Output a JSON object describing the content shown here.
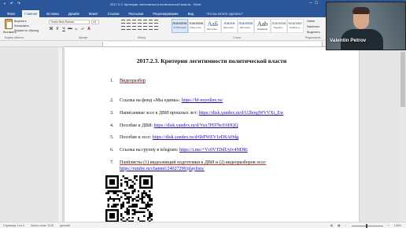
{
  "window": {
    "title": "2017.2.3. Критерии легитимности политической власти - Word",
    "quick_access": [
      "save-icon",
      "undo-icon",
      "redo-icon"
    ]
  },
  "tabs": [
    {
      "label": "Файл",
      "active": false
    },
    {
      "label": "Главная",
      "active": true
    },
    {
      "label": "Вставка",
      "active": false
    },
    {
      "label": "Дизайн",
      "active": false
    },
    {
      "label": "Макет",
      "active": false
    },
    {
      "label": "Ссылки",
      "active": false
    },
    {
      "label": "Рассылки",
      "active": false
    },
    {
      "label": "Рецензирование",
      "active": false
    },
    {
      "label": "Вид",
      "active": false
    },
    {
      "label": "Что вы хотите сделать?",
      "active": false
    }
  ],
  "ribbon": {
    "clipboard": {
      "paste": "Вставить",
      "cut": "Вырезать",
      "copy": "Копировать",
      "format_painter": "Формат по образцу",
      "group": "Буфер обмена"
    },
    "font": {
      "name": "Times New Roman",
      "size": "14",
      "group": "Шрифт",
      "buttons": [
        "Ж",
        "К",
        "Ч",
        "abc",
        "x₂",
        "x²"
      ]
    },
    "paragraph": {
      "group": "Абзац"
    },
    "styles": {
      "group": "Стили",
      "items": [
        {
          "sample": "АаБбВвГг",
          "name": "¶ Обычный",
          "active": true
        },
        {
          "sample": "АаБбВвГг",
          "name": "¶ Без инте...",
          "active": false
        },
        {
          "sample": "АаБ",
          "name": "Заголово...",
          "active": false,
          "big": true
        },
        {
          "sample": "АаБбВ",
          "name": "Заголово...",
          "active": false
        },
        {
          "sample": "АаБбВвГ",
          "name": "Заголово...",
          "active": false
        },
        {
          "sample": "Aab",
          "name": "Название",
          "active": false,
          "big": true
        },
        {
          "sample": "АаБбВвГ",
          "name": "Подзаго...",
          "active": false
        },
        {
          "sample": "АаБбВвГг",
          "name": "Слабое в...",
          "active": false
        }
      ]
    },
    "editing": {
      "find": "Найти",
      "replace": "Заменить",
      "select": "Выделить",
      "group": "Редактиров..."
    }
  },
  "document": {
    "title": "2017.2.3. Критерии легитимности политической власти",
    "items": [
      {
        "num": "1.",
        "text": "Видеоразбор",
        "link": ""
      },
      {
        "num": "2.",
        "text": "Ссылка на фонд «Мы едины»: ",
        "link": "https://bf-myediny.ru/"
      },
      {
        "num": "3.",
        "text": "Написанные эссе к ДВИ прошлых лет: ",
        "link": "https://disk.yandex.ru/d/U2boqjWVVXi_Ew"
      },
      {
        "num": "4.",
        "text": "Пособие к ДВИ: ",
        "link": "https://disk.yandex.ru/d/Yux7PD7hcE6HQQ"
      },
      {
        "num": "5.",
        "text": "Пособие к эссе: ",
        "link": "https://disk.yandex.ru/d/6bPWEV1eDSAHdg"
      },
      {
        "num": "6.",
        "text": "Ссылка на группу в telegram: ",
        "link": "https://t.me/+Vc0VTDdUyiv4NDRi"
      },
      {
        "num": "7.",
        "text": "Плейлисты (1) видеолекций подготовки к ДВИ и (2) видеоразборов эссе:",
        "link": "https://rutube.ru/channel/24027290/playlists/"
      }
    ]
  },
  "status": {
    "page": "Страница 1 из 4",
    "words": "Число слов: 1128",
    "lang": "русский",
    "zoom": "140%"
  },
  "webcam": {
    "name": "Valentin Petrov"
  }
}
